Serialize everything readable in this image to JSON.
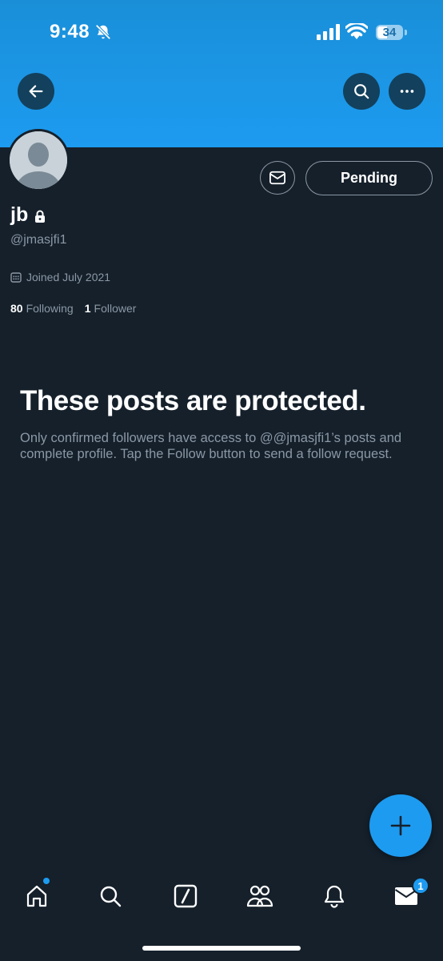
{
  "status_bar": {
    "time": "9:48",
    "battery": "34",
    "icons": [
      "bell-slash-icon",
      "signal-icon",
      "wifi-icon",
      "battery-icon"
    ]
  },
  "header": {
    "back_icon": "arrow-left-icon",
    "search_icon": "search-icon",
    "more_icon": "ellipsis-icon",
    "banner_color": "#1d9bf0"
  },
  "profile": {
    "name": "jb",
    "handle": "@jmasjfi1",
    "joined": "Joined July 2021",
    "following_count": "80",
    "following_label": "Following",
    "followers_count": "1",
    "followers_label": "Follower",
    "action_button": "Pending"
  },
  "protected": {
    "title": "These posts are protected.",
    "body": "Only confirmed followers have access to @@jmasjfi1’s posts and complete profile. Tap the Follow button to send a follow request."
  },
  "tabbar": {
    "items": [
      "home-icon",
      "search-icon",
      "grok-icon",
      "communities-icon",
      "bell-icon",
      "mail-icon"
    ],
    "messages_badge": "1"
  },
  "colors": {
    "background": "#15202b",
    "accent": "#1d9bf0",
    "secondary_text": "#8b98a5"
  }
}
